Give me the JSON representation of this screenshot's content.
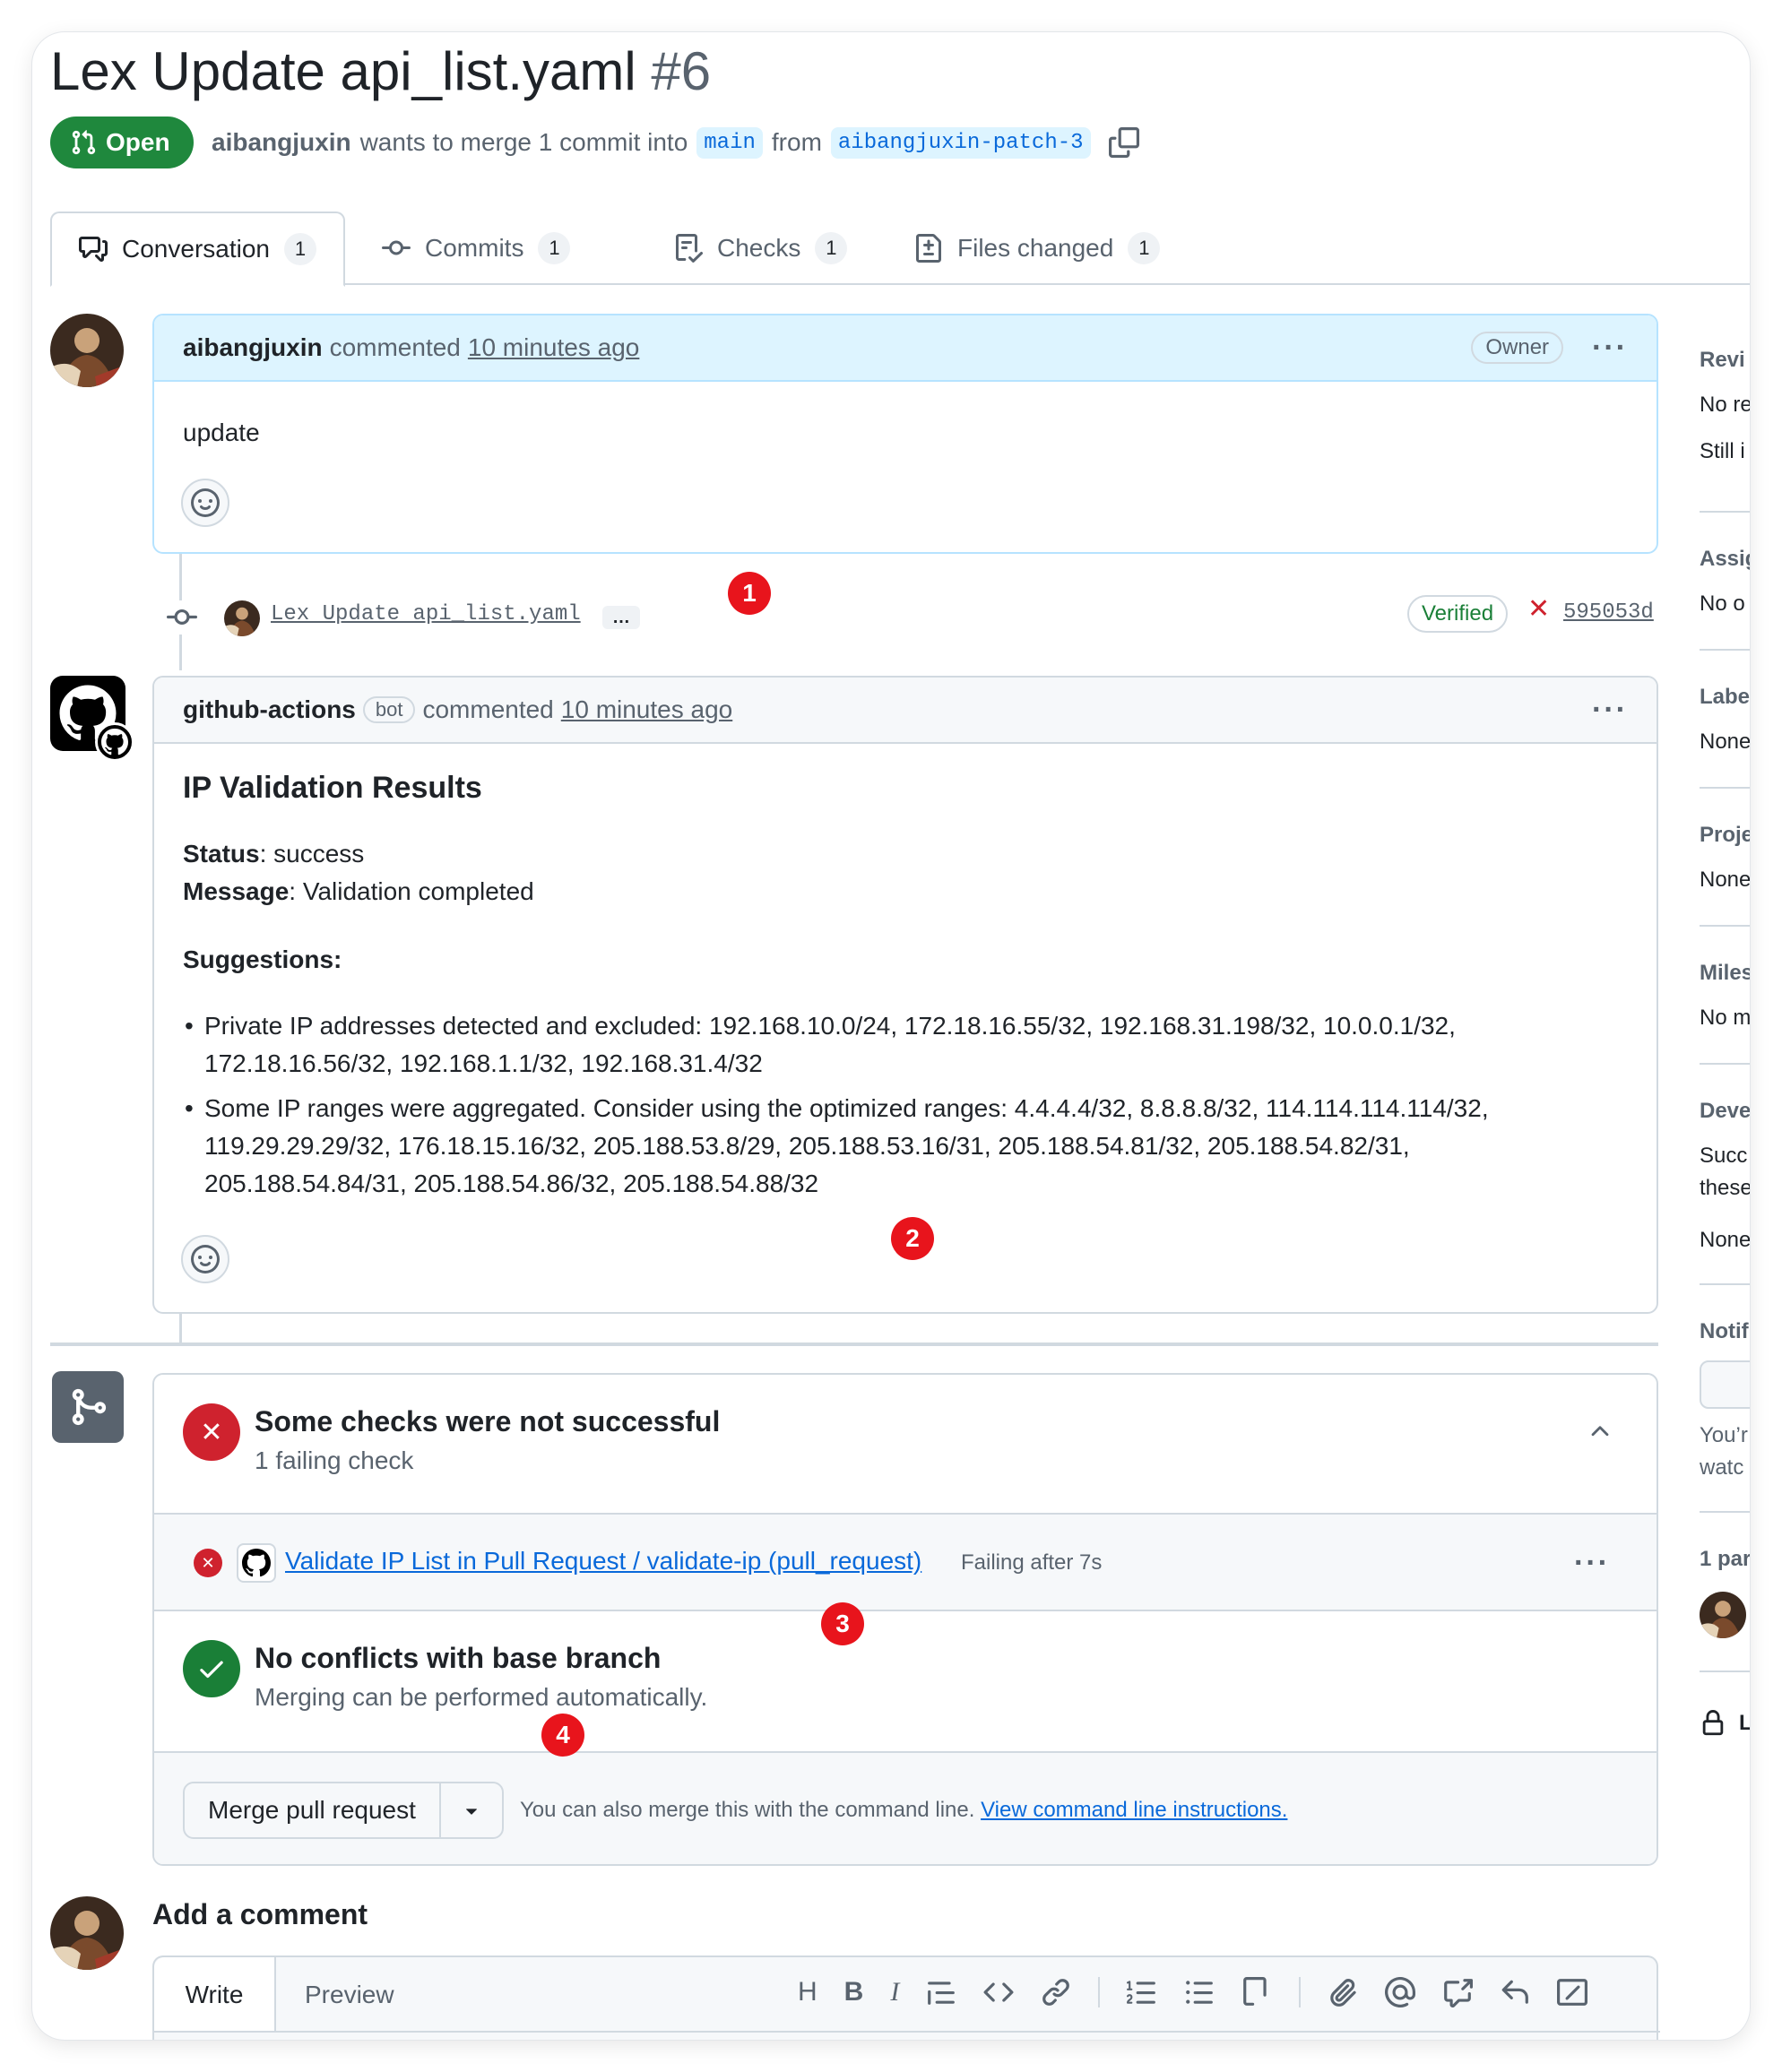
{
  "pr": {
    "title": "Lex Update api_list.yaml",
    "number": "#6",
    "state": "Open",
    "author": "aibangjuxin",
    "merge_text": "wants to merge 1 commit into",
    "base_branch": "main",
    "from_text": "from",
    "head_branch": "aibangjuxin-patch-3"
  },
  "tabs": [
    {
      "label": "Conversation",
      "count": "1"
    },
    {
      "label": "Commits",
      "count": "1"
    },
    {
      "label": "Checks",
      "count": "1"
    },
    {
      "label": "Files changed",
      "count": "1"
    }
  ],
  "comment1": {
    "author": "aibangjuxin",
    "action": "commented",
    "time": "10 minutes ago",
    "role": "Owner",
    "body": "update"
  },
  "commit": {
    "message": "Lex Update api_list.yaml",
    "ellipsis": "…",
    "verified": "Verified",
    "sha": "595053d"
  },
  "comment2": {
    "author": "github-actions",
    "bot": "bot",
    "action": "commented",
    "time": "10 minutes ago",
    "heading": "IP Validation Results",
    "status_label": "Status",
    "status_value": ": success",
    "message_label": "Message",
    "message_value": ": Validation completed",
    "suggestions_label": "Suggestions:",
    "bullet1_line1": "Private IP addresses detected and excluded: 192.168.10.0/24, 172.18.16.55/32, 192.168.31.198/32, 10.0.0.1/32,",
    "bullet1_line2": "172.18.16.56/32, 192.168.1.1/32, 192.168.31.4/32",
    "bullet2_line1": "Some IP ranges were aggregated. Consider using the optimized ranges: 4.4.4.4/32, 8.8.8.8/32, 114.114.114.114/32,",
    "bullet2_line2": "119.29.29.29/32, 176.18.15.16/32, 205.188.53.8/29, 205.188.53.16/31, 205.188.54.81/32, 205.188.54.82/31,",
    "bullet2_line3": "205.188.54.84/31, 205.188.54.86/32, 205.188.54.88/32"
  },
  "checks": {
    "title": "Some checks were not successful",
    "subtitle": "1 failing check",
    "check_name": "Validate IP List in Pull Request / validate-ip (pull_request)",
    "check_status": "Failing after 7s",
    "conflicts_title": "No conflicts with base branch",
    "conflicts_sub": "Merging can be performed automatically.",
    "merge_button": "Merge pull request",
    "cli_text": "You can also merge this with the command line.",
    "cli_link": "View command line instructions."
  },
  "add_comment": {
    "title": "Add a comment",
    "write_tab": "Write",
    "preview_tab": "Preview"
  },
  "sidebar": {
    "reviewers_h": "Revi",
    "reviewers_t1": "No re",
    "reviewers_t2": "Still i",
    "assignees_h": "Assig",
    "assignees_t": "No o",
    "labels_h": "Labe",
    "labels_t": "None",
    "projects_h": "Proje",
    "projects_t": "None",
    "milestone_h": "Miles",
    "milestone_t": "No m",
    "development_h": "Deve",
    "development_t1": "Succ",
    "development_t2": "these",
    "development_t3": "None",
    "notifications_h": "Notif",
    "notifications_t1": "You’r",
    "notifications_t2": "watc",
    "participants_h": "1 par",
    "lock_t": "L"
  },
  "markers": [
    "1",
    "2",
    "3",
    "4"
  ],
  "colors": {
    "open_green": "#1f883d",
    "fail_red": "#cf222e",
    "success_green": "#1a7f37",
    "link_blue": "#0969da",
    "marker_red": "#e8141c"
  }
}
